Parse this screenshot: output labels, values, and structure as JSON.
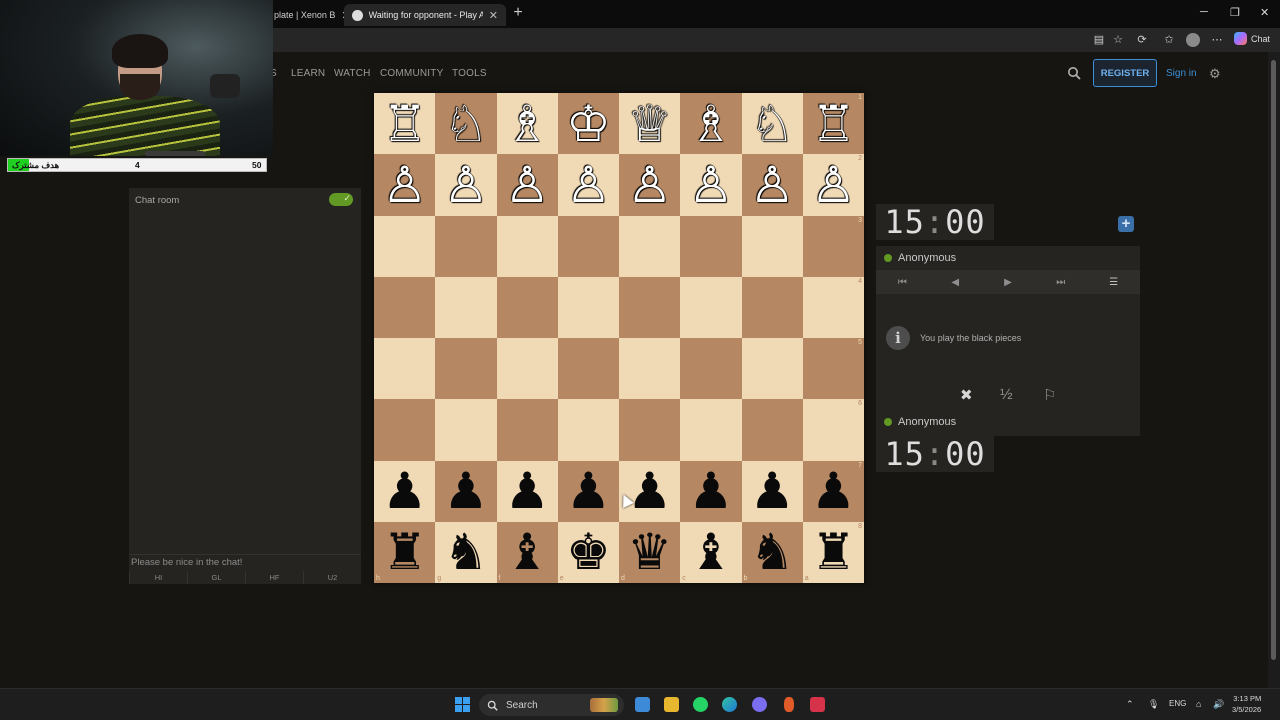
{
  "browser": {
    "tabs": [
      {
        "title": "plate | Xenon B",
        "active": false
      },
      {
        "title": "Waiting for opponent - Play Anon",
        "active": true
      }
    ],
    "copilot_label": "Chat"
  },
  "site_nav": {
    "items": [
      "S",
      "LEARN",
      "WATCH",
      "COMMUNITY",
      "TOOLS"
    ],
    "register_label": "REGISTER",
    "signin_label": "Sign in"
  },
  "webcam_overlay": {
    "goal_label": "هدف مشترک",
    "goal_current": "4",
    "goal_target": "50",
    "goal_progress": 0.08
  },
  "chat": {
    "title": "Chat room",
    "placeholder": "Please be nice in the chat!",
    "presets": [
      "HI",
      "GL",
      "HF",
      "U2"
    ],
    "enabled": true
  },
  "board": {
    "orientation": "black",
    "ranks": [
      [
        "♖",
        "♘",
        "♗",
        "♔",
        "♕",
        "♗",
        "♘",
        "♖"
      ],
      [
        "♙",
        "♙",
        "♙",
        "♙",
        "♙",
        "♙",
        "♙",
        "♙"
      ],
      [
        "",
        "",
        "",
        "",
        "",
        "",
        "",
        ""
      ],
      [
        "",
        "",
        "",
        "",
        "",
        "",
        "",
        ""
      ],
      [
        "",
        "",
        "",
        "",
        "",
        "",
        "",
        ""
      ],
      [
        "",
        "",
        "",
        "",
        "",
        "",
        "",
        ""
      ],
      [
        "♟",
        "♟",
        "♟",
        "♟",
        "♟",
        "♟",
        "♟",
        "♟"
      ],
      [
        "♜",
        "♞",
        "♝",
        "♚",
        "♛",
        "♝",
        "♞",
        "♜"
      ]
    ],
    "rank_labels": [
      "1",
      "2",
      "3",
      "4",
      "5",
      "6",
      "7",
      "8"
    ],
    "file_labels": [
      "h",
      "g",
      "f",
      "e",
      "d",
      "c",
      "b",
      "a"
    ]
  },
  "game": {
    "top_clock": {
      "min": "15",
      "sec": "00"
    },
    "bottom_clock": {
      "min": "15",
      "sec": "00"
    },
    "top_player": "Anonymous",
    "bottom_player": "Anonymous",
    "info_message": "You play the black pieces",
    "draw_symbol": "½"
  },
  "taskbar": {
    "search_label": "Search",
    "lang": "ENG",
    "time": "3:13 PM",
    "date": "3/5/2026"
  },
  "colors": {
    "light_square": "#f0d9b5",
    "dark_square": "#b58863",
    "accent_blue": "#3a8fd8",
    "online_green": "#629924"
  }
}
